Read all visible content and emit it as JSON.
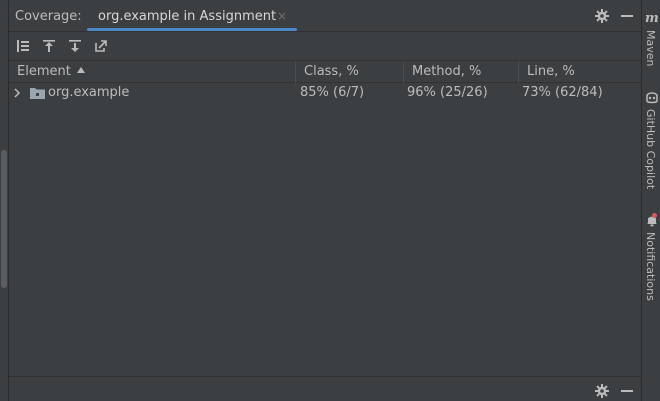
{
  "header": {
    "label": "Coverage:",
    "tab_title": "org.example in Assignment",
    "tab_close": "×"
  },
  "toolbar": {
    "buttons": [
      "flatten-packages-icon",
      "import-icon",
      "export-icon",
      "generate-report-icon"
    ]
  },
  "table": {
    "columns": [
      "Element",
      "Class, %",
      "Method, %",
      "Line, %"
    ],
    "sort_column": "Element",
    "sort_direction": "ascending",
    "rows": [
      {
        "element": "org.example",
        "class": "85% (6/7)",
        "method": "96% (25/26)",
        "line": "73% (62/84)"
      }
    ]
  },
  "right_strip": {
    "maven": "Maven",
    "copilot": "GitHub Copilot",
    "notifications": "Notifications"
  },
  "colors": {
    "background": "#3c3f41",
    "text": "#bbbbbb",
    "accent": "#4a88c7",
    "notification_dot": "#e05555"
  }
}
